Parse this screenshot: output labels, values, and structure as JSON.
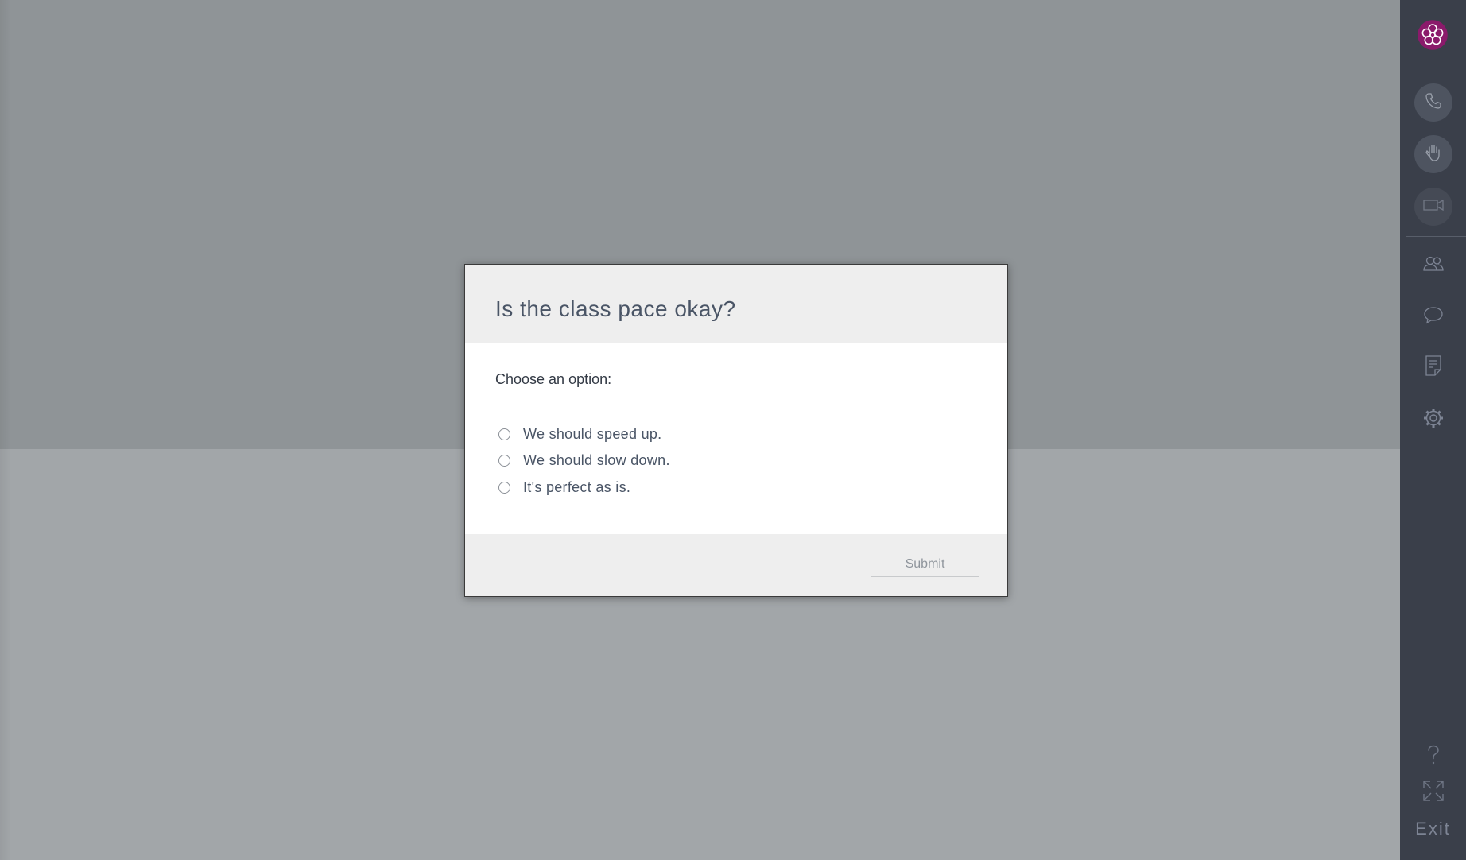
{
  "modal": {
    "title": "Is the class pace okay?",
    "prompt": "Choose an option:",
    "options": [
      {
        "label": "We should speed up.",
        "checked": false
      },
      {
        "label": "We should slow down.",
        "checked": false
      },
      {
        "label": "It's perfect as is.",
        "checked": false
      }
    ],
    "submit_label": "Submit",
    "submit_enabled": false
  },
  "rail": {
    "logo": "flower-logo-icon",
    "buttons": [
      {
        "icon": "phone-icon"
      },
      {
        "icon": "raise-hand-icon"
      },
      {
        "icon": "video-camera-icon"
      }
    ],
    "panel_icons": [
      {
        "icon": "participants-icon"
      },
      {
        "icon": "chat-icon"
      },
      {
        "icon": "notes-icon"
      },
      {
        "icon": "settings-gear-icon"
      }
    ],
    "bottom_icons": [
      {
        "icon": "help-icon"
      },
      {
        "icon": "fullscreen-icon"
      }
    ],
    "exit_label": "Exit"
  },
  "colors": {
    "rail_bg": "#3a3f4a",
    "logo_accent": "#8b1a6b",
    "backdrop_top": "#8f9497",
    "backdrop_bottom": "#a2a6a9"
  }
}
